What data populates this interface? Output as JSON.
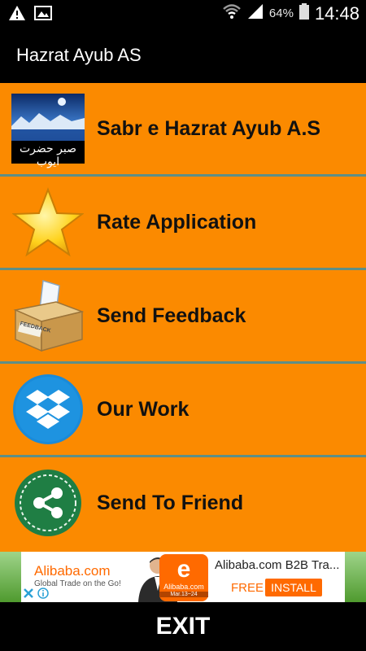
{
  "status_bar": {
    "battery": "64%",
    "time": "14:48",
    "icons": [
      "warning-icon",
      "image-icon",
      "wifi-icon",
      "signal-icon",
      "battery-icon"
    ]
  },
  "app_bar": {
    "title": "Hazrat Ayub AS"
  },
  "menu": {
    "items": [
      {
        "label": "Sabr e Hazrat Ayub A.S",
        "icon": "book-cover-icon",
        "cover_text": "صبر حضرت ایوب"
      },
      {
        "label": "Rate Application",
        "icon": "star-icon"
      },
      {
        "label": "Send Feedback",
        "icon": "feedback-box-icon",
        "icon_text": "FEEDBACK"
      },
      {
        "label": "Our Work",
        "icon": "dropbox-icon"
      },
      {
        "label": "Send To Friend",
        "icon": "share-icon"
      }
    ]
  },
  "ad": {
    "brand": "Alibaba.com",
    "tagline": "Global Trade on the Go!",
    "logo_name": "Alibaba.com",
    "logo_date": "Mar.13~24",
    "title": "Alibaba.com B2B Tra...",
    "free_label": "FREE",
    "install_label": "INSTALL"
  },
  "footer": {
    "exit_label": "EXIT"
  },
  "colors": {
    "menu_background": "#fb8a00",
    "divider": "#5e8f86",
    "bar": "#000000"
  }
}
